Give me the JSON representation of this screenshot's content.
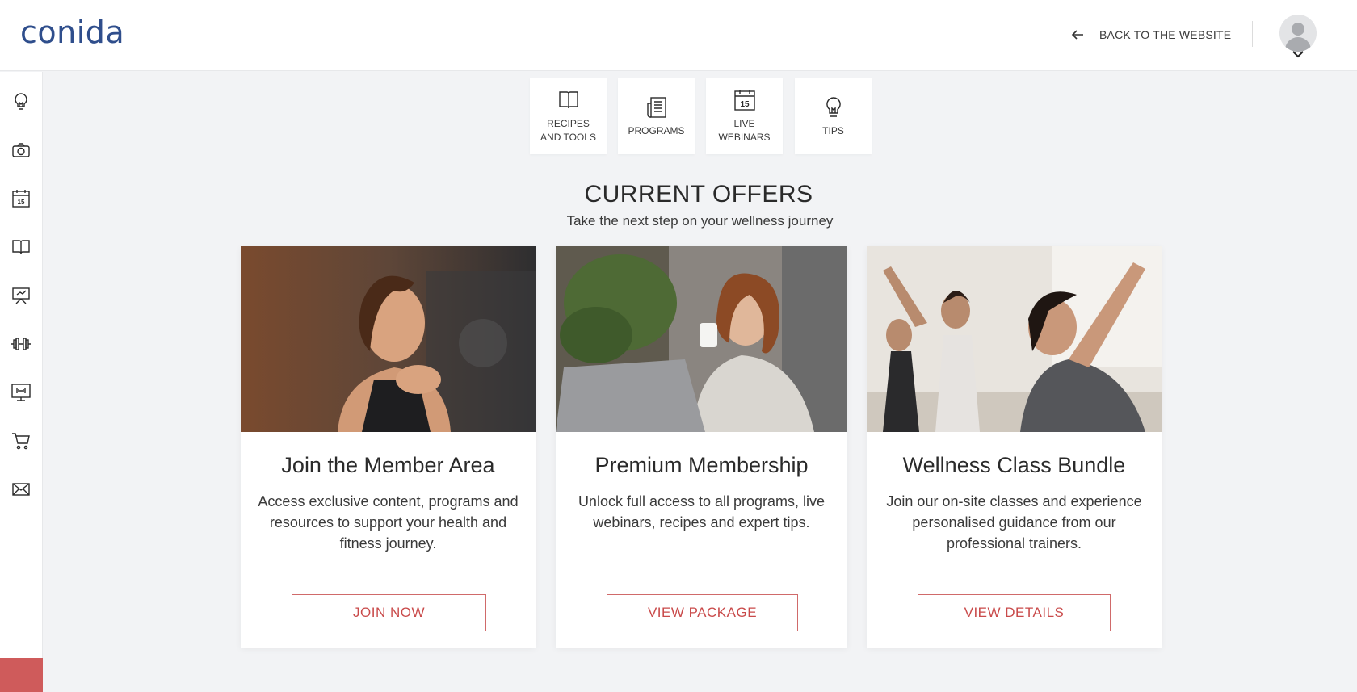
{
  "header": {
    "logo_text": "conida",
    "back_label": "BACK TO THE WEBSITE",
    "back_icon": "arrow-left-icon",
    "avatar_icon": "user-avatar-icon",
    "menu_icon": "chevron-down-icon"
  },
  "sidebar": {
    "items": [
      {
        "icon": "lightbulb-icon"
      },
      {
        "icon": "camera-icon"
      },
      {
        "icon": "calendar-icon",
        "text": "15"
      },
      {
        "icon": "book-icon"
      },
      {
        "icon": "presentation-icon"
      },
      {
        "icon": "dumbbell-icon"
      },
      {
        "icon": "monitor-dumbbell-icon"
      },
      {
        "icon": "cart-icon"
      },
      {
        "icon": "mail-icon"
      }
    ],
    "accent_color": "#cf5b5b"
  },
  "categories": [
    {
      "label": "RECIPES AND TOOLS",
      "icon": "book-icon"
    },
    {
      "label": "PROGRAMS",
      "icon": "newspaper-icon"
    },
    {
      "label": "LIVE WEBINARS",
      "icon": "calendar-icon",
      "icon_text": "15"
    },
    {
      "label": "TIPS",
      "icon": "lightbulb-icon"
    }
  ],
  "offers": {
    "title": "CURRENT OFFERS",
    "subtitle": "Take the next step on your wellness journey",
    "cards": [
      {
        "title": "Join the Member Area",
        "description": "Access exclusive content, programs and resources to support your health and fitness journey.",
        "button": "JOIN NOW"
      },
      {
        "title": "Premium Membership",
        "description": "Unlock full access to all programs, live webinars, recipes and expert tips.",
        "button": "VIEW PACKAGE"
      },
      {
        "title": "Wellness Class Bundle",
        "description": "Join our on-site classes and experience personalised guidance from our professional trainers.",
        "button": "VIEW DETAILS"
      }
    ]
  },
  "colors": {
    "brand": "#2f4e8c",
    "accent": "#c94a4a",
    "background": "#f2f3f5"
  }
}
